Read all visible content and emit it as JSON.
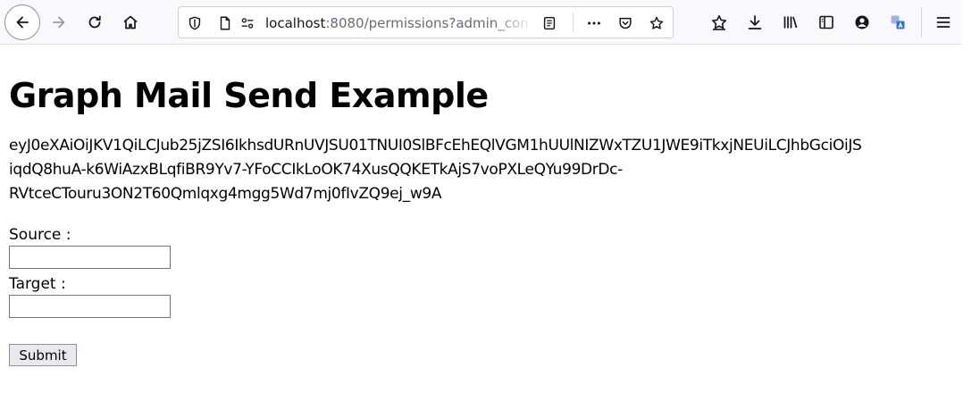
{
  "browser": {
    "url_host": "localhost",
    "url_rest": ":8080/permissions?admin_con",
    "toolbar_icons": {
      "back": "back-arrow-icon",
      "forward": "forward-arrow-icon",
      "reload": "reload-icon",
      "home": "home-icon",
      "shield": "tracking-protection-icon",
      "page": "page-info-icon",
      "permissions": "permissions-icon",
      "reader": "reader-view-icon",
      "more": "more-actions-icon",
      "pocket": "pocket-icon",
      "bookmark": "bookmark-star-icon",
      "reading_list": "reading-list-icon",
      "downloads": "download-icon",
      "library": "library-icon",
      "sidebar": "sidebar-icon",
      "account": "account-icon",
      "translate": "translate-icon",
      "menu": "hamburger-menu-icon"
    }
  },
  "page": {
    "title": "Graph Mail Send Example",
    "token": "eyJ0eXAiOiJKV1QiLCJub25jZSI6IkhsdURnUVJSU01TNUI0SlBFcEhEQlVGM1hUUlNIZWxTZU1JWE9iTkxjNEUiLCJhbGciOiJS\niqdQ8huA-k6WiAzxBLqfiBR9Yv7-YFoCCIkLoOK74XusQQKETkAjS7voPXLeQYu99DrDc-\nRVtceCTouru3ON2T60Qmlqxg4mgg5Wd7mj0fIvZQ9ej_w9A"
  },
  "form": {
    "source_label": "Source :",
    "source_value": "",
    "target_label": "Target :",
    "target_value": "",
    "submit_label": "Submit"
  }
}
